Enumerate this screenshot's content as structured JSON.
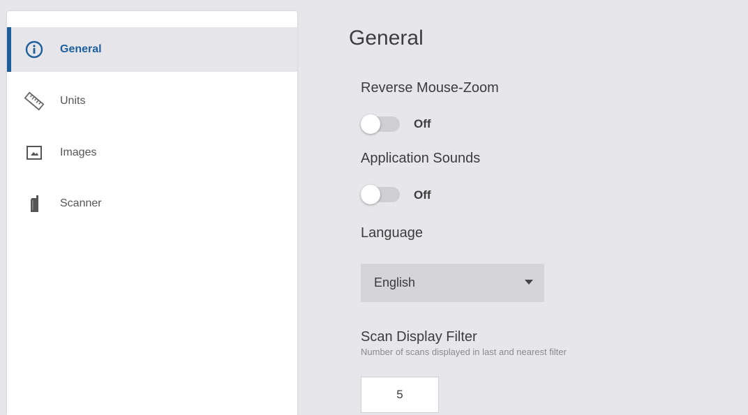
{
  "sidebar": {
    "items": [
      {
        "label": "General",
        "icon": "info-icon",
        "active": true
      },
      {
        "label": "Units",
        "icon": "ruler-icon",
        "active": false
      },
      {
        "label": "Images",
        "icon": "image-icon",
        "active": false
      },
      {
        "label": "Scanner",
        "icon": "scanner-icon",
        "active": false
      }
    ]
  },
  "main": {
    "title": "General",
    "reverse_mouse_zoom": {
      "label": "Reverse Mouse-Zoom",
      "state": "Off"
    },
    "application_sounds": {
      "label": "Application Sounds",
      "state": "Off"
    },
    "language": {
      "label": "Language",
      "value": "English"
    },
    "scan_display_filter": {
      "label": "Scan Display Filter",
      "description": "Number of scans displayed in last and nearest filter",
      "value": "5"
    }
  },
  "colors": {
    "accent": "#1d5f9c",
    "background": "#e7e6ea",
    "sidebar_bg": "#ffffff",
    "active_item_bg": "#e6e5ea",
    "toggle_track": "#cfcfd3",
    "select_bg": "#d5d4d9"
  }
}
